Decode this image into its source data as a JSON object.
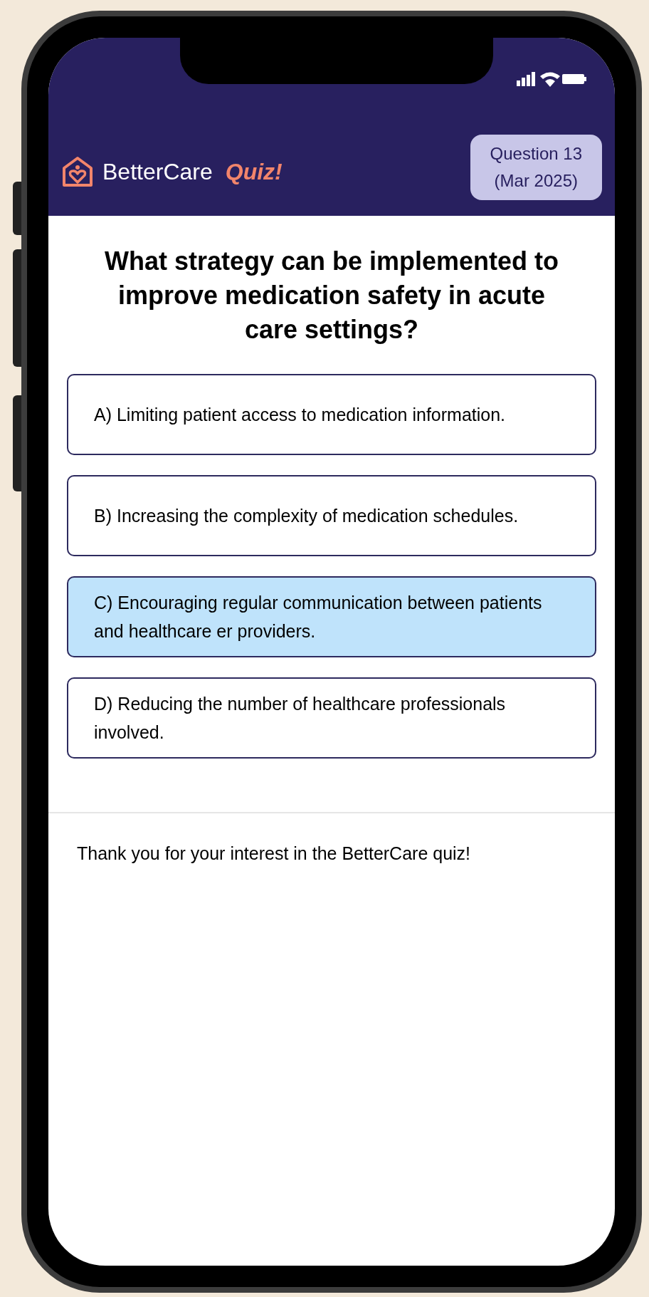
{
  "header": {
    "brand": "BetterCare",
    "brand_accent": "Quiz!",
    "badge_lines": [
      "Question 13",
      "(Mar 2025)"
    ]
  },
  "question": "What strategy can be implemented to improve medication safety in acute care settings?",
  "options": [
    {
      "text": "A) Limiting patient access to medication information.",
      "selected": false
    },
    {
      "text": "B) Increasing the complexity of medication schedules.",
      "selected": false
    },
    {
      "text": "C) Encouraging regular communication between patients and healthcare er providers.",
      "selected": true
    },
    {
      "text": "D) Reducing the number of healthcare professionals involved.",
      "selected": false
    }
  ],
  "footer_text": "Thank you for your interest in the BetterCare quiz!"
}
